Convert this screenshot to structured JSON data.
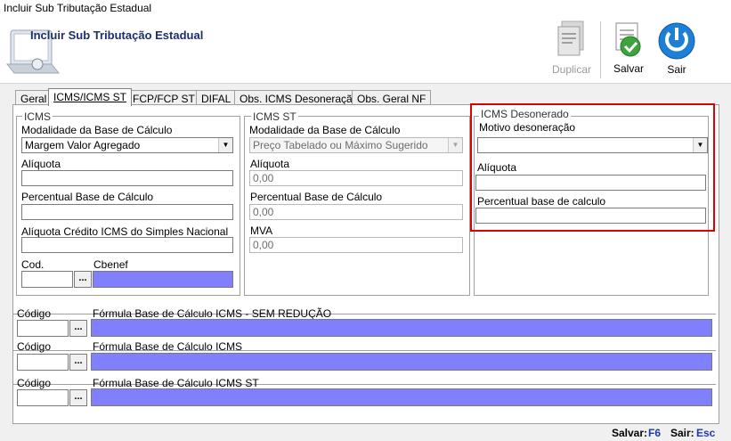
{
  "window": {
    "title": "Incluir Sub Tributação Estadual"
  },
  "header": {
    "title": "Incluir Sub Tributação Estadual"
  },
  "toolbar": {
    "duplicar_label": "Duplicar",
    "salvar_label": "Salvar",
    "sair_label": "Sair"
  },
  "tabs": [
    {
      "label": "Geral"
    },
    {
      "label": "ICMS/ICMS ST"
    },
    {
      "label": "FCP/FCP ST"
    },
    {
      "label": "DIFAL"
    },
    {
      "label": "Obs. ICMS Desoneração"
    },
    {
      "label": "Obs. Geral NF"
    }
  ],
  "icms": {
    "legend": "ICMS",
    "modalidade_label": "Modalidade da Base de Cálculo",
    "modalidade_value": "Margem Valor Agregado",
    "aliquota_label": "Alíquota",
    "aliquota_value": "",
    "percentual_label": "Percentual Base de Cálculo",
    "percentual_value": "",
    "credito_label": "Alíquota Crédito ICMS do Simples Nacional",
    "credito_value": "",
    "cod_label": "Cod.",
    "cbenef_label": "Cbenef",
    "dots_label": "..."
  },
  "icms_st": {
    "legend": "ICMS ST",
    "modalidade_label": "Modalidade da Base de Cálculo",
    "modalidade_value": "Preço Tabelado ou Máximo Sugerido",
    "aliquota_label": "Alíquota",
    "aliquota_value": "0,00",
    "percentual_label": "Percentual Base de Cálculo",
    "percentual_value": "0,00",
    "mva_label": "MVA",
    "mva_value": "0,00"
  },
  "icms_desonerado": {
    "legend": "ICMS Desonerado",
    "motivo_label": "Motivo desoneração",
    "motivo_value": "",
    "aliquota_label": "Alíquota",
    "aliquota_value": "",
    "percentual_label": "Percentual base de calculo",
    "percentual_value": ""
  },
  "formulas": [
    {
      "codigo_label": "Código",
      "formula_label": "Fórmula Base de Cálculo ICMS - SEM REDUÇÃO",
      "dots": "..."
    },
    {
      "codigo_label": "Código",
      "formula_label": "Fórmula Base de Cálculo ICMS",
      "dots": "..."
    },
    {
      "codigo_label": "Código",
      "formula_label": "Fórmula Base de Cálculo ICMS ST",
      "dots": "..."
    }
  ],
  "footer": {
    "salvar_label": "Salvar:",
    "salvar_key": "F6",
    "sair_label": "Sair:",
    "sair_key": "Esc"
  },
  "colors": {
    "highlight": "#e00000",
    "lookup_field": "#8080ff",
    "title_text": "#1b2f6b",
    "shortcut_key": "#1f3ab0"
  }
}
